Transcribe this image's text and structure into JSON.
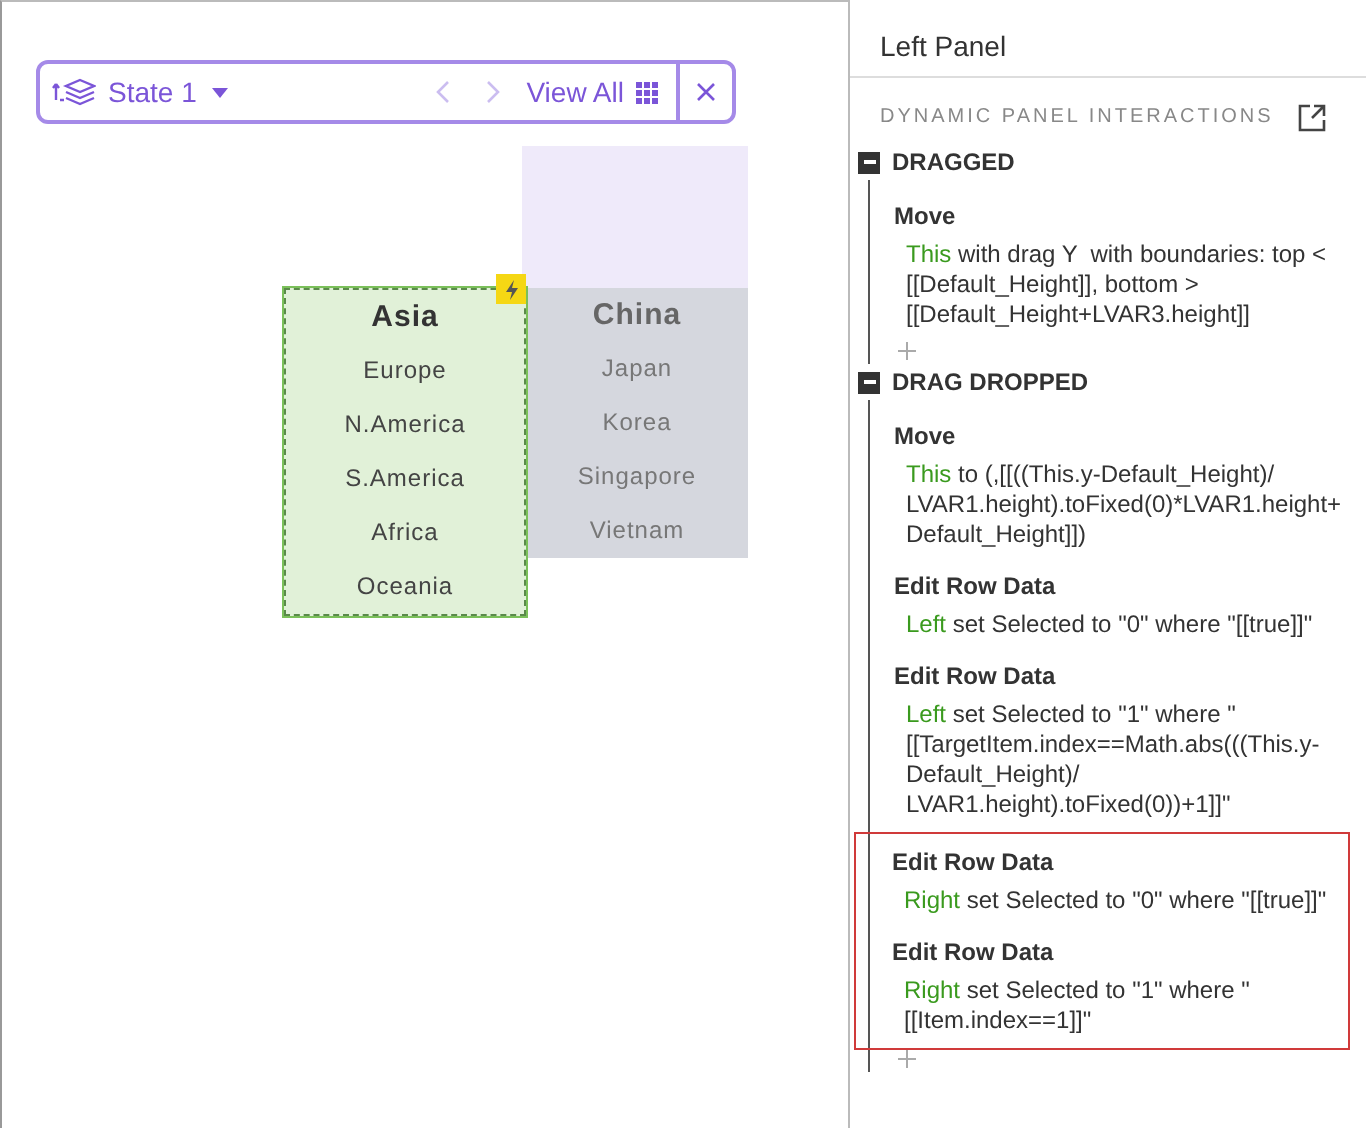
{
  "toolbar": {
    "state_label": "State 1",
    "nav": [
      {
        "kind": "prev",
        "disabled": true
      },
      {
        "kind": "next",
        "disabled": true
      }
    ],
    "view_all": "View All"
  },
  "canvas": {
    "lists": [
      {
        "kind": "dragged",
        "items": [
          {
            "label": "Asia",
            "selected": true
          },
          {
            "label": "Europe",
            "selected": false
          },
          {
            "label": "N.America",
            "selected": false
          },
          {
            "label": "S.America",
            "selected": false
          },
          {
            "label": "Africa",
            "selected": false
          },
          {
            "label": "Oceania",
            "selected": false
          }
        ]
      },
      {
        "kind": "static",
        "items": [
          {
            "label": "China",
            "selected": true
          },
          {
            "label": "Japan",
            "selected": false
          },
          {
            "label": "Korea",
            "selected": false
          },
          {
            "label": "Singapore",
            "selected": false
          },
          {
            "label": "Vietnam",
            "selected": false
          }
        ]
      }
    ]
  },
  "panel": {
    "title": "Left Panel",
    "section": "DYNAMIC PANEL INTERACTIONS",
    "events": [
      {
        "name": "DRAGGED",
        "expanded": true,
        "actions": [
          {
            "title": "Move",
            "target": "This",
            "text": " with drag Y  with boundaries: top < [[Default_Height]], bottom > [[Default_Height+LVAR3.height]]",
            "highlighted": false
          }
        ]
      },
      {
        "name": "DRAG DROPPED",
        "expanded": true,
        "actions": [
          {
            "title": "Move",
            "target": "This",
            "text": " to (,[[((This.y-Default_Height)/ LVAR1.height).toFixed(0)*LVAR1.height+Default_Height]])",
            "highlighted": false
          },
          {
            "title": "Edit Row Data",
            "target": "Left",
            "text": " set Selected to \"0\" where \"[[true]]\"",
            "highlighted": false
          },
          {
            "title": "Edit Row Data",
            "target": "Left",
            "text": " set Selected to \"1\" where \"[[TargetItem.index==Math.abs(((This.y-Default_Height)/ LVAR1.height).toFixed(0))+1]]\"",
            "highlighted": false
          },
          {
            "title": "Edit Row Data",
            "target": "Right",
            "text": " set Selected to \"0\" where \"[[true]]\"",
            "highlighted": true
          },
          {
            "title": "Edit Row Data",
            "target": "Right",
            "text": " set Selected to \"1\" where \"[[Item.index==1]]\"",
            "highlighted": true
          }
        ]
      }
    ]
  }
}
